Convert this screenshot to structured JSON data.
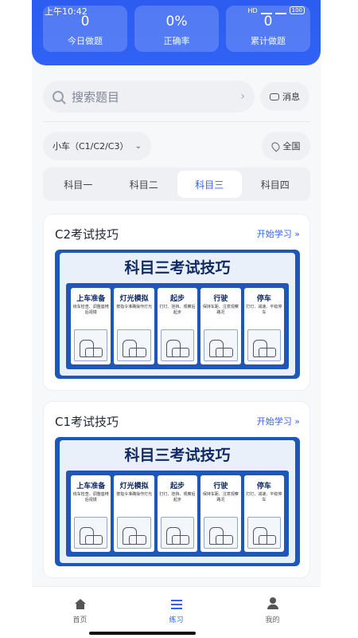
{
  "status_bar": {
    "time": "上午10:42",
    "battery": "100",
    "network": "HD"
  },
  "stats": [
    {
      "value": "0",
      "label": "今日做题"
    },
    {
      "value": "0%",
      "label": "正确率"
    },
    {
      "value": "0",
      "label": "累计做题"
    }
  ],
  "search": {
    "placeholder": "搜索题目",
    "message_label": "消息"
  },
  "filters": {
    "car_type": "小车（C1/C2/C3）",
    "region": "全国"
  },
  "tabs": [
    "科目一",
    "科目二",
    "科目三",
    "科目四"
  ],
  "active_tab": "科目三",
  "cards": [
    {
      "title": "C2考试技巧",
      "link": "开始学习 »",
      "banner_title": "科目三考试技巧",
      "panels": [
        {
          "head": "上车准备",
          "sub": "绕车检查、调整座椅后视镜"
        },
        {
          "head": "灯光模拟",
          "sub": "按指令准确操作灯光"
        },
        {
          "head": "起步",
          "sub": "打灯、挂挡、观察后起步"
        },
        {
          "head": "行驶",
          "sub": "保持车距、注意观察路况"
        },
        {
          "head": "停车",
          "sub": "打灯、减速、平稳停车"
        }
      ]
    },
    {
      "title": "C1考试技巧",
      "link": "开始学习 »",
      "banner_title": "科目三考试技巧",
      "panels": [
        {
          "head": "上车准备",
          "sub": "绕车检查、调整座椅后视镜"
        },
        {
          "head": "灯光模拟",
          "sub": "按指令准确操作灯光"
        },
        {
          "head": "起步",
          "sub": "打灯、挂挡、观察后起步"
        },
        {
          "head": "行驶",
          "sub": "保持车距、注意观察路况"
        },
        {
          "head": "停车",
          "sub": "打灯、减速、平稳停车"
        }
      ]
    }
  ],
  "bottom_nav": [
    {
      "label": "首页",
      "icon": "home-icon"
    },
    {
      "label": "练习",
      "icon": "list-icon"
    },
    {
      "label": "我的",
      "icon": "user-icon"
    }
  ],
  "colors": {
    "accent": "#2f62f5",
    "header": "#2c5cf0",
    "banner": "#1d58b8"
  }
}
